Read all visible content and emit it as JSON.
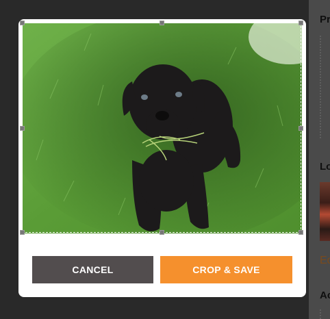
{
  "modal": {
    "cancel_label": "CANCEL",
    "save_label": "CROP & SAVE"
  },
  "side_panel": {
    "heading_1": "Pr",
    "heading_2": "Lo",
    "edit_text": "Ed",
    "heading_3": "Ac"
  },
  "colors": {
    "accent": "#f5902d",
    "cancel": "#524d4e",
    "backdrop": "#292929"
  }
}
